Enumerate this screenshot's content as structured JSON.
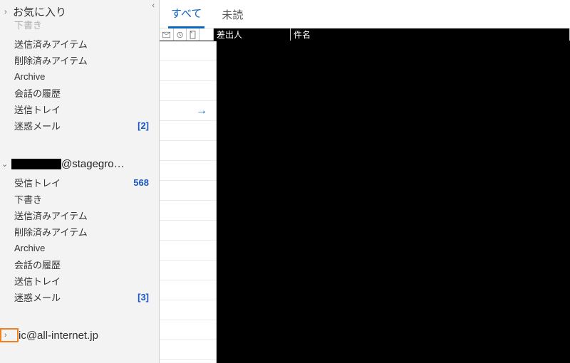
{
  "sidebar": {
    "favorites_label": "お気に入り",
    "fav_truncated": "下書き",
    "fav_items": [
      {
        "label": "送信済みアイテム",
        "count": ""
      },
      {
        "label": "削除済みアイテム",
        "count": ""
      },
      {
        "label": "Archive",
        "count": ""
      },
      {
        "label": "会話の履歴",
        "count": ""
      },
      {
        "label": "送信トレイ",
        "count": ""
      },
      {
        "label": "迷惑メール",
        "count": "[2]"
      }
    ],
    "account1_suffix": "@stagegro…",
    "account1_items": [
      {
        "label": "受信トレイ",
        "count": "568"
      },
      {
        "label": "下書き",
        "count": ""
      },
      {
        "label": "送信済みアイテム",
        "count": ""
      },
      {
        "label": "削除済みアイテム",
        "count": ""
      },
      {
        "label": "Archive",
        "count": ""
      },
      {
        "label": "会話の履歴",
        "count": ""
      },
      {
        "label": "送信トレイ",
        "count": ""
      },
      {
        "label": "迷惑メール",
        "count": "[3]"
      }
    ],
    "account2_label": "ic@all-internet.jp"
  },
  "tabs": {
    "all": "すべて",
    "unread": "未読"
  },
  "columns": {
    "sender": "差出人",
    "subject": "件名"
  }
}
